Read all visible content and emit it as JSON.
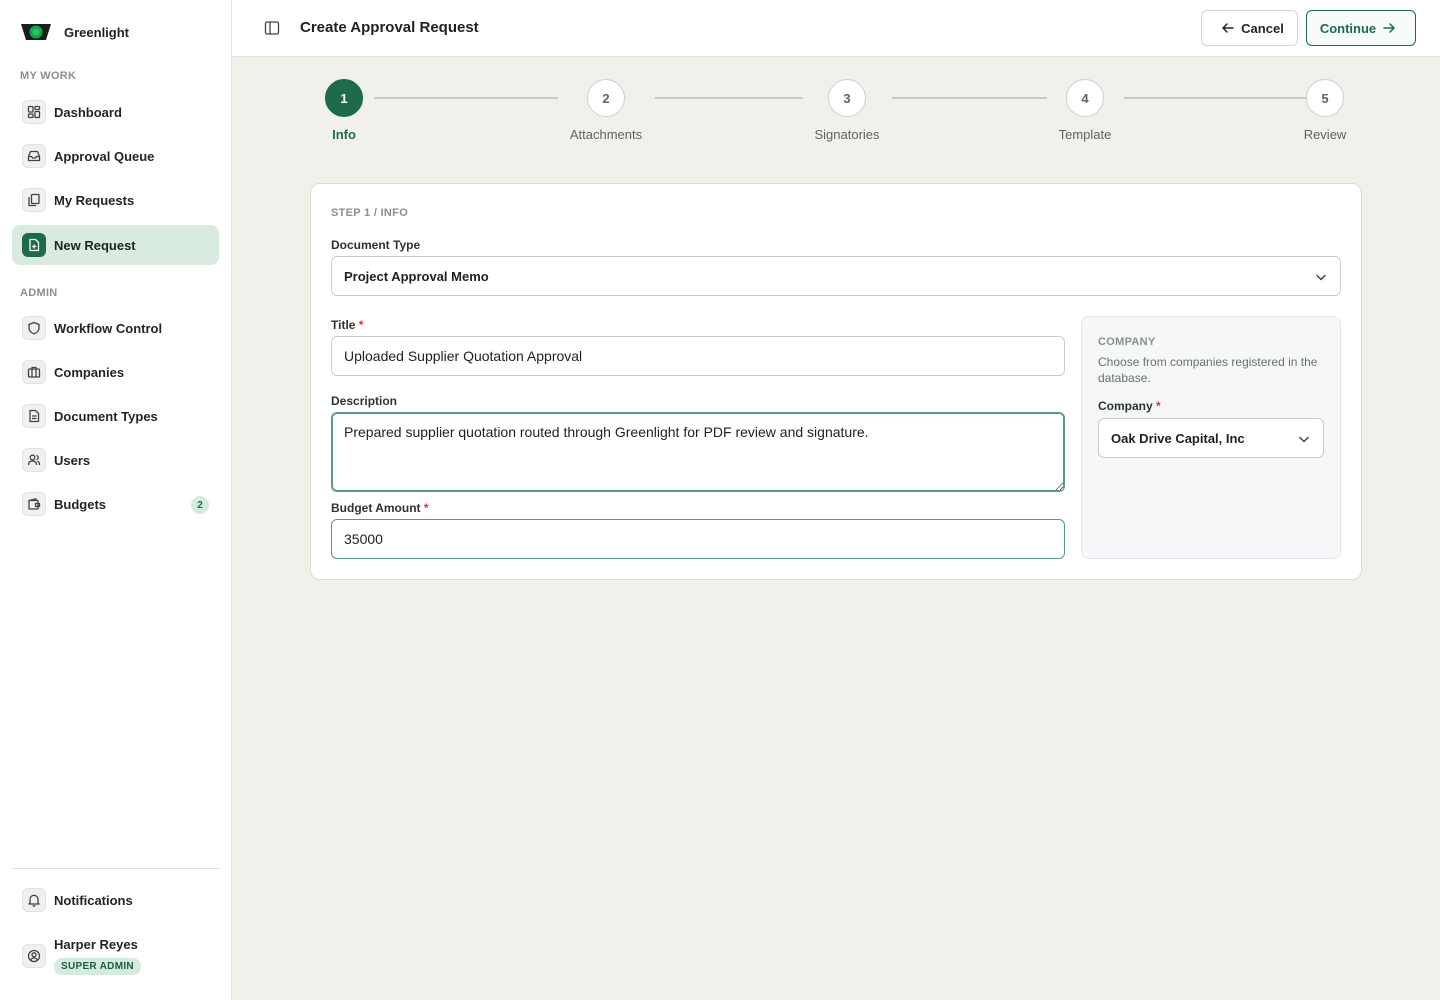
{
  "brand": {
    "name": "Greenlight"
  },
  "sidebar": {
    "my_work_label": "MY WORK",
    "admin_label": "ADMIN",
    "my_work_items": [
      {
        "label": "Dashboard",
        "icon": "dashboard-icon"
      },
      {
        "label": "Approval Queue",
        "icon": "inbox-icon"
      },
      {
        "label": "My Requests",
        "icon": "copy-icon"
      },
      {
        "label": "New Request",
        "icon": "file-plus-icon",
        "active": true
      }
    ],
    "admin_items": [
      {
        "label": "Workflow Control",
        "icon": "shield-icon"
      },
      {
        "label": "Companies",
        "icon": "briefcase-icon"
      },
      {
        "label": "Document Types",
        "icon": "document-icon"
      },
      {
        "label": "Users",
        "icon": "users-icon"
      },
      {
        "label": "Budgets",
        "icon": "wallet-icon",
        "badge": "2"
      }
    ],
    "notifications_label": "Notifications",
    "user": {
      "name": "Harper Reyes",
      "role": "SUPER ADMIN"
    }
  },
  "header": {
    "title": "Create Approval Request",
    "cancel_label": "Cancel",
    "continue_label": "Continue"
  },
  "stepper": {
    "steps": [
      {
        "number": "1",
        "label": "Info",
        "active": true
      },
      {
        "number": "2",
        "label": "Attachments"
      },
      {
        "number": "3",
        "label": "Signatories"
      },
      {
        "number": "4",
        "label": "Template"
      },
      {
        "number": "5",
        "label": "Review"
      }
    ]
  },
  "form": {
    "eyebrow": "STEP 1 / INFO",
    "document_type_label": "Document Type",
    "document_type_value": "Project Approval Memo",
    "title_label": "Title",
    "title_value": "Uploaded Supplier Quotation Approval",
    "description_label": "Description",
    "description_value": "Prepared supplier quotation routed through Greenlight for PDF review and signature.",
    "budget_label": "Budget Amount",
    "budget_value": "35000",
    "required_marker": "*"
  },
  "company": {
    "eyebrow": "COMPANY",
    "help": "Choose from companies registered in the database.",
    "label": "Company",
    "value": "Oak Drive Capital, Inc"
  },
  "colors": {
    "accent": "#1e6b49",
    "accent_soft": "#d9ebe1",
    "required": "#d2332f"
  }
}
